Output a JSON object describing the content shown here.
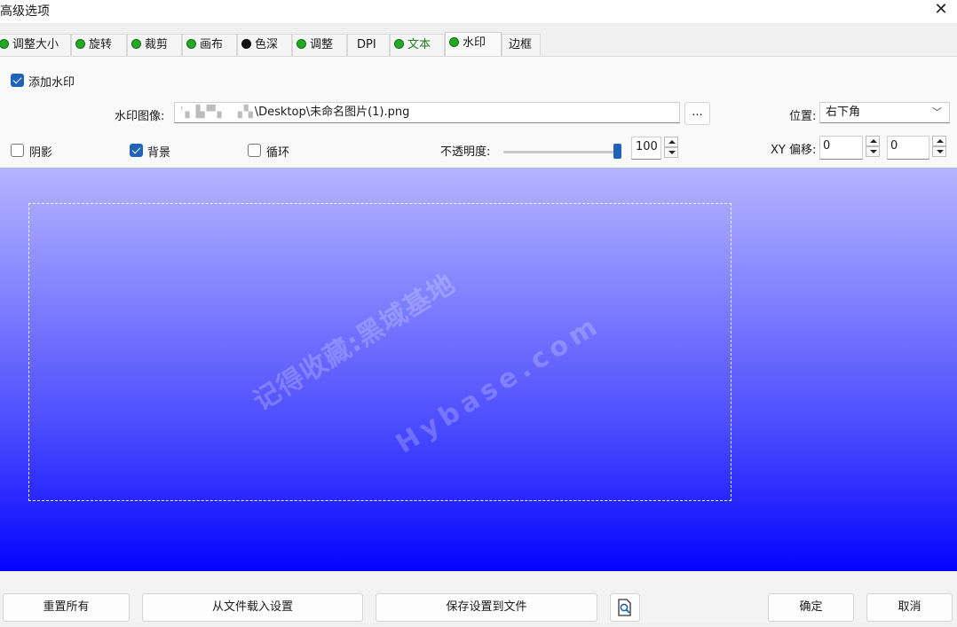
{
  "window": {
    "title": "高级选项",
    "close_icon": "close-icon"
  },
  "tabs": [
    {
      "label": "调整大小",
      "dot": "#22aa22"
    },
    {
      "label": "旋转",
      "dot": "#22aa22"
    },
    {
      "label": "裁剪",
      "dot": "#22aa22"
    },
    {
      "label": "画布",
      "dot": "#22aa22"
    },
    {
      "label": "色深",
      "dot": "#111111"
    },
    {
      "label": "调整",
      "dot": "#22aa22"
    },
    {
      "label": "DPI",
      "dot": ""
    },
    {
      "label": "文本",
      "dot": "#22aa22"
    },
    {
      "label": "水印",
      "dot": "#22aa22",
      "active": true
    },
    {
      "label": "边框",
      "dot": ""
    }
  ],
  "watermark": {
    "enable_label": "添加水印",
    "enable_checked": true,
    "image_label": "水印图像:",
    "image_path_prefix": "'▖▙▀▖ ▗▚",
    "image_path": "\\Desktop\\未命名图片(1).png",
    "browse_label": "...",
    "position_label": "位置:",
    "position_value": "右下角",
    "shadow_label": "阴影",
    "shadow_checked": false,
    "background_label": "背景",
    "background_checked": true,
    "loop_label": "循环",
    "loop_checked": false,
    "opacity_label": "不透明度:",
    "opacity_value": "100",
    "opacity_level": 1.0,
    "xy_offset_label": "XY 偏移:",
    "offset_x": "0",
    "offset_y": "0"
  },
  "preview": {
    "watermark_text": "记得收藏:黑域基地",
    "watermark_text2": "Hybase.com",
    "gradient_top": "#b4b4ff",
    "gradient_bottom": "#0404ff"
  },
  "footer": {
    "reset_all": "重置所有",
    "load_from_file": "从文件载入设置",
    "save_to_file": "保存设置到文件",
    "preview_icon": "preview-zoom-icon",
    "ok": "确定",
    "cancel": "取消"
  },
  "colors": {
    "accent": "#1e63b9",
    "active_dot": "#22aa22"
  }
}
